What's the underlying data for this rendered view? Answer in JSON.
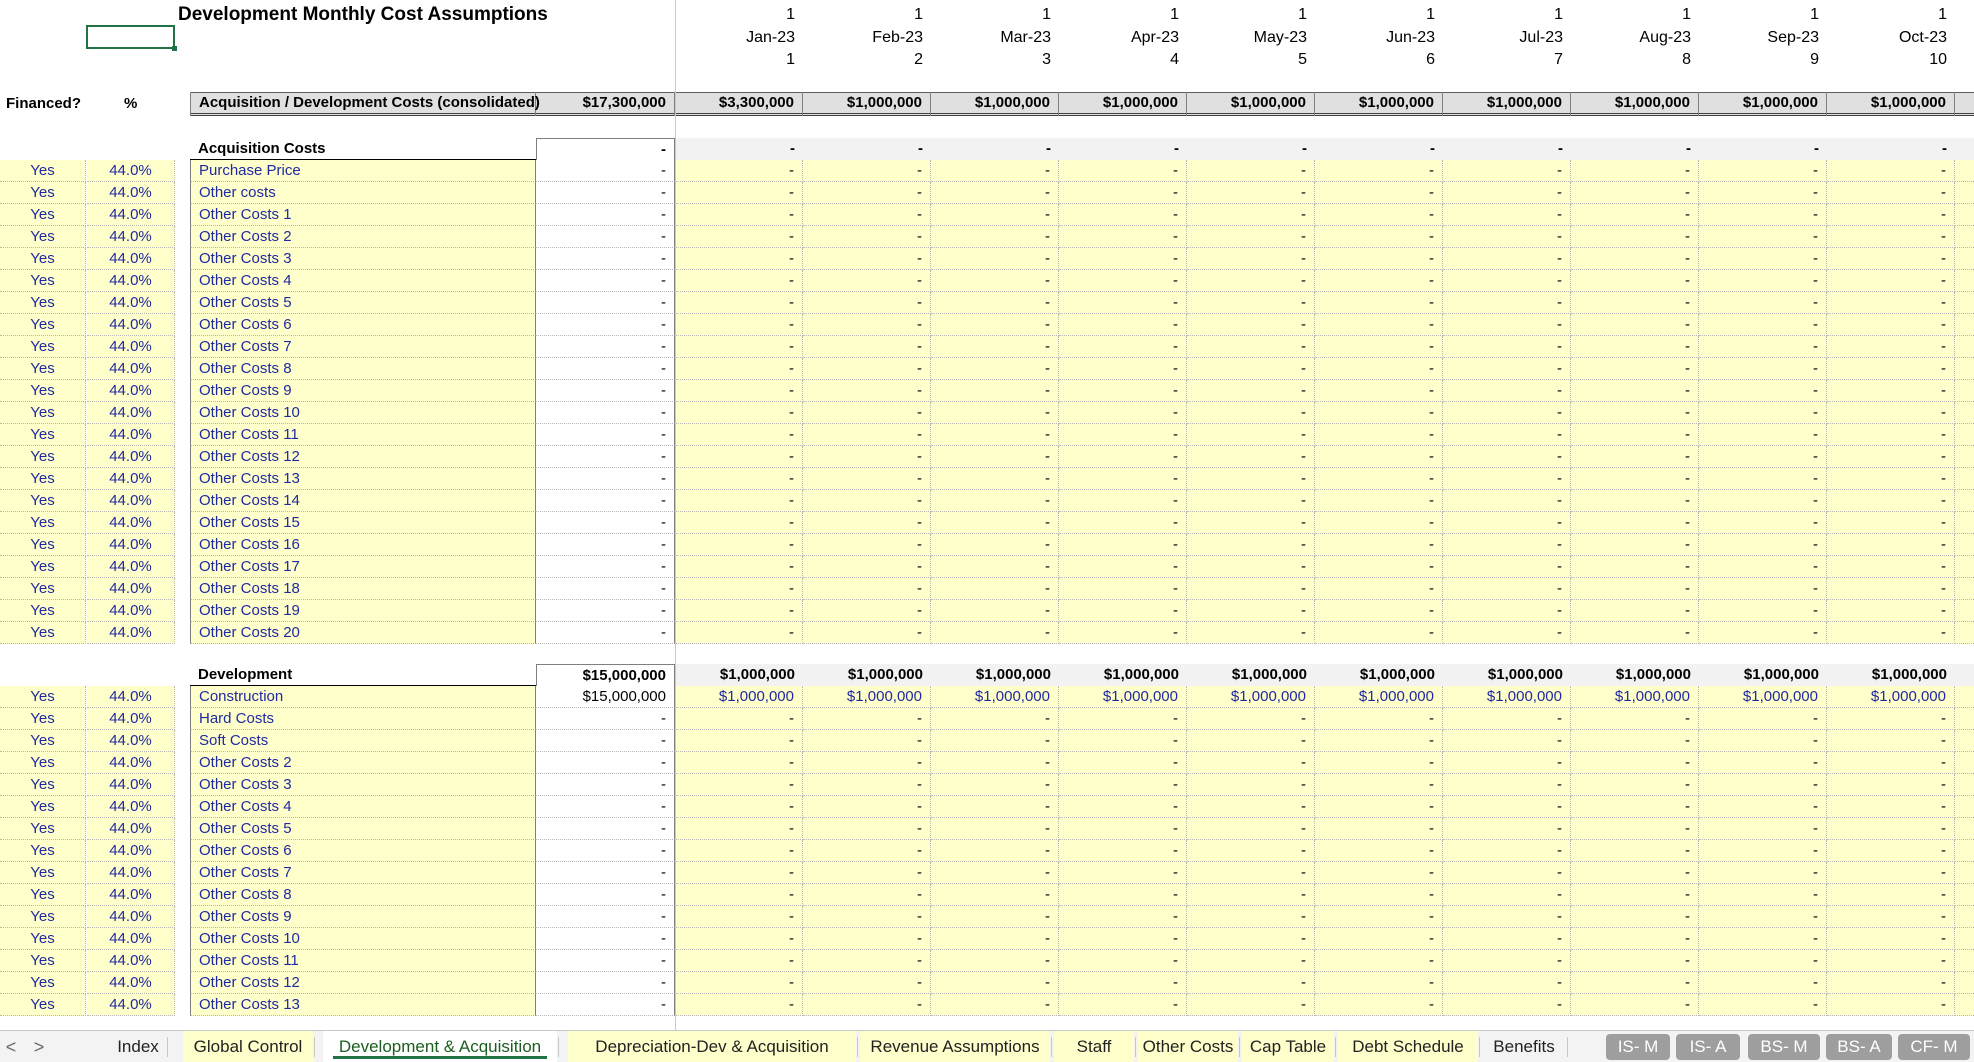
{
  "sheet": {
    "title": "Development Monthly Cost Assumptions",
    "header_left": {
      "financed": "Financed?",
      "pct": "%"
    },
    "months": [
      {
        "top": "1",
        "label": "Jan-23",
        "idx": "1"
      },
      {
        "top": "1",
        "label": "Feb-23",
        "idx": "2"
      },
      {
        "top": "1",
        "label": "Mar-23",
        "idx": "3"
      },
      {
        "top": "1",
        "label": "Apr-23",
        "idx": "4"
      },
      {
        "top": "1",
        "label": "May-23",
        "idx": "5"
      },
      {
        "top": "1",
        "label": "Jun-23",
        "idx": "6"
      },
      {
        "top": "1",
        "label": "Jul-23",
        "idx": "7"
      },
      {
        "top": "1",
        "label": "Aug-23",
        "idx": "8"
      },
      {
        "top": "1",
        "label": "Sep-23",
        "idx": "9"
      },
      {
        "top": "1",
        "label": "Oct-23",
        "idx": "10"
      }
    ],
    "consolidated": {
      "label": "Acquisition / Development Costs (consolidated)",
      "total": "$17,300,000",
      "values": [
        "$3,300,000",
        "$1,000,000",
        "$1,000,000",
        "$1,000,000",
        "$1,000,000",
        "$1,000,000",
        "$1,000,000",
        "$1,000,000",
        "$1,000,000",
        "$1,000,000"
      ]
    },
    "acquisition": {
      "heading": "Acquisition Costs",
      "total": "-",
      "month_totals": [
        "-",
        "-",
        "-",
        "-",
        "-",
        "-",
        "-",
        "-",
        "-",
        "-"
      ],
      "rows": [
        {
          "financed": "Yes",
          "pct": "44.0%",
          "label": "Purchase Price",
          "total": "-",
          "values": [
            "-",
            "-",
            "-",
            "-",
            "-",
            "-",
            "-",
            "-",
            "-",
            "-"
          ]
        },
        {
          "financed": "Yes",
          "pct": "44.0%",
          "label": "Other costs",
          "total": "-",
          "values": [
            "-",
            "-",
            "-",
            "-",
            "-",
            "-",
            "-",
            "-",
            "-",
            "-"
          ]
        },
        {
          "financed": "Yes",
          "pct": "44.0%",
          "label": "Other Costs 1",
          "total": "-",
          "values": [
            "-",
            "-",
            "-",
            "-",
            "-",
            "-",
            "-",
            "-",
            "-",
            "-"
          ]
        },
        {
          "financed": "Yes",
          "pct": "44.0%",
          "label": "Other Costs 2",
          "total": "-",
          "values": [
            "-",
            "-",
            "-",
            "-",
            "-",
            "-",
            "-",
            "-",
            "-",
            "-"
          ]
        },
        {
          "financed": "Yes",
          "pct": "44.0%",
          "label": "Other Costs 3",
          "total": "-",
          "values": [
            "-",
            "-",
            "-",
            "-",
            "-",
            "-",
            "-",
            "-",
            "-",
            "-"
          ]
        },
        {
          "financed": "Yes",
          "pct": "44.0%",
          "label": "Other Costs 4",
          "total": "-",
          "values": [
            "-",
            "-",
            "-",
            "-",
            "-",
            "-",
            "-",
            "-",
            "-",
            "-"
          ]
        },
        {
          "financed": "Yes",
          "pct": "44.0%",
          "label": "Other Costs 5",
          "total": "-",
          "values": [
            "-",
            "-",
            "-",
            "-",
            "-",
            "-",
            "-",
            "-",
            "-",
            "-"
          ]
        },
        {
          "financed": "Yes",
          "pct": "44.0%",
          "label": "Other Costs 6",
          "total": "-",
          "values": [
            "-",
            "-",
            "-",
            "-",
            "-",
            "-",
            "-",
            "-",
            "-",
            "-"
          ]
        },
        {
          "financed": "Yes",
          "pct": "44.0%",
          "label": "Other Costs 7",
          "total": "-",
          "values": [
            "-",
            "-",
            "-",
            "-",
            "-",
            "-",
            "-",
            "-",
            "-",
            "-"
          ]
        },
        {
          "financed": "Yes",
          "pct": "44.0%",
          "label": "Other Costs 8",
          "total": "-",
          "values": [
            "-",
            "-",
            "-",
            "-",
            "-",
            "-",
            "-",
            "-",
            "-",
            "-"
          ]
        },
        {
          "financed": "Yes",
          "pct": "44.0%",
          "label": "Other Costs 9",
          "total": "-",
          "values": [
            "-",
            "-",
            "-",
            "-",
            "-",
            "-",
            "-",
            "-",
            "-",
            "-"
          ]
        },
        {
          "financed": "Yes",
          "pct": "44.0%",
          "label": "Other Costs 10",
          "total": "-",
          "values": [
            "-",
            "-",
            "-",
            "-",
            "-",
            "-",
            "-",
            "-",
            "-",
            "-"
          ]
        },
        {
          "financed": "Yes",
          "pct": "44.0%",
          "label": "Other Costs 11",
          "total": "-",
          "values": [
            "-",
            "-",
            "-",
            "-",
            "-",
            "-",
            "-",
            "-",
            "-",
            "-"
          ]
        },
        {
          "financed": "Yes",
          "pct": "44.0%",
          "label": "Other Costs 12",
          "total": "-",
          "values": [
            "-",
            "-",
            "-",
            "-",
            "-",
            "-",
            "-",
            "-",
            "-",
            "-"
          ]
        },
        {
          "financed": "Yes",
          "pct": "44.0%",
          "label": "Other Costs 13",
          "total": "-",
          "values": [
            "-",
            "-",
            "-",
            "-",
            "-",
            "-",
            "-",
            "-",
            "-",
            "-"
          ]
        },
        {
          "financed": "Yes",
          "pct": "44.0%",
          "label": "Other Costs 14",
          "total": "-",
          "values": [
            "-",
            "-",
            "-",
            "-",
            "-",
            "-",
            "-",
            "-",
            "-",
            "-"
          ]
        },
        {
          "financed": "Yes",
          "pct": "44.0%",
          "label": "Other Costs 15",
          "total": "-",
          "values": [
            "-",
            "-",
            "-",
            "-",
            "-",
            "-",
            "-",
            "-",
            "-",
            "-"
          ]
        },
        {
          "financed": "Yes",
          "pct": "44.0%",
          "label": "Other Costs 16",
          "total": "-",
          "values": [
            "-",
            "-",
            "-",
            "-",
            "-",
            "-",
            "-",
            "-",
            "-",
            "-"
          ]
        },
        {
          "financed": "Yes",
          "pct": "44.0%",
          "label": "Other Costs 17",
          "total": "-",
          "values": [
            "-",
            "-",
            "-",
            "-",
            "-",
            "-",
            "-",
            "-",
            "-",
            "-"
          ]
        },
        {
          "financed": "Yes",
          "pct": "44.0%",
          "label": "Other Costs 18",
          "total": "-",
          "values": [
            "-",
            "-",
            "-",
            "-",
            "-",
            "-",
            "-",
            "-",
            "-",
            "-"
          ]
        },
        {
          "financed": "Yes",
          "pct": "44.0%",
          "label": "Other Costs 19",
          "total": "-",
          "values": [
            "-",
            "-",
            "-",
            "-",
            "-",
            "-",
            "-",
            "-",
            "-",
            "-"
          ]
        },
        {
          "financed": "Yes",
          "pct": "44.0%",
          "label": "Other Costs 20",
          "total": "-",
          "values": [
            "-",
            "-",
            "-",
            "-",
            "-",
            "-",
            "-",
            "-",
            "-",
            "-"
          ]
        }
      ]
    },
    "development": {
      "heading": "Development",
      "total": "$15,000,000",
      "month_totals": [
        "$1,000,000",
        "$1,000,000",
        "$1,000,000",
        "$1,000,000",
        "$1,000,000",
        "$1,000,000",
        "$1,000,000",
        "$1,000,000",
        "$1,000,000",
        "$1,000,000"
      ],
      "rows": [
        {
          "financed": "Yes",
          "pct": "44.0%",
          "label": "Construction",
          "total": "$15,000,000",
          "values": [
            "$1,000,000",
            "$1,000,000",
            "$1,000,000",
            "$1,000,000",
            "$1,000,000",
            "$1,000,000",
            "$1,000,000",
            "$1,000,000",
            "$1,000,000",
            "$1,000,000"
          ]
        },
        {
          "financed": "Yes",
          "pct": "44.0%",
          "label": "Hard Costs",
          "total": "-",
          "values": [
            "-",
            "-",
            "-",
            "-",
            "-",
            "-",
            "-",
            "-",
            "-",
            "-"
          ]
        },
        {
          "financed": "Yes",
          "pct": "44.0%",
          "label": "Soft Costs",
          "total": "-",
          "values": [
            "-",
            "-",
            "-",
            "-",
            "-",
            "-",
            "-",
            "-",
            "-",
            "-"
          ]
        },
        {
          "financed": "Yes",
          "pct": "44.0%",
          "label": "Other Costs 2",
          "total": "-",
          "values": [
            "-",
            "-",
            "-",
            "-",
            "-",
            "-",
            "-",
            "-",
            "-",
            "-"
          ]
        },
        {
          "financed": "Yes",
          "pct": "44.0%",
          "label": "Other Costs 3",
          "total": "-",
          "values": [
            "-",
            "-",
            "-",
            "-",
            "-",
            "-",
            "-",
            "-",
            "-",
            "-"
          ]
        },
        {
          "financed": "Yes",
          "pct": "44.0%",
          "label": "Other Costs 4",
          "total": "-",
          "values": [
            "-",
            "-",
            "-",
            "-",
            "-",
            "-",
            "-",
            "-",
            "-",
            "-"
          ]
        },
        {
          "financed": "Yes",
          "pct": "44.0%",
          "label": "Other Costs 5",
          "total": "-",
          "values": [
            "-",
            "-",
            "-",
            "-",
            "-",
            "-",
            "-",
            "-",
            "-",
            "-"
          ]
        },
        {
          "financed": "Yes",
          "pct": "44.0%",
          "label": "Other Costs 6",
          "total": "-",
          "values": [
            "-",
            "-",
            "-",
            "-",
            "-",
            "-",
            "-",
            "-",
            "-",
            "-"
          ]
        },
        {
          "financed": "Yes",
          "pct": "44.0%",
          "label": "Other Costs 7",
          "total": "-",
          "values": [
            "-",
            "-",
            "-",
            "-",
            "-",
            "-",
            "-",
            "-",
            "-",
            "-"
          ]
        },
        {
          "financed": "Yes",
          "pct": "44.0%",
          "label": "Other Costs 8",
          "total": "-",
          "values": [
            "-",
            "-",
            "-",
            "-",
            "-",
            "-",
            "-",
            "-",
            "-",
            "-"
          ]
        },
        {
          "financed": "Yes",
          "pct": "44.0%",
          "label": "Other Costs 9",
          "total": "-",
          "values": [
            "-",
            "-",
            "-",
            "-",
            "-",
            "-",
            "-",
            "-",
            "-",
            "-"
          ]
        },
        {
          "financed": "Yes",
          "pct": "44.0%",
          "label": "Other Costs 10",
          "total": "-",
          "values": [
            "-",
            "-",
            "-",
            "-",
            "-",
            "-",
            "-",
            "-",
            "-",
            "-"
          ]
        },
        {
          "financed": "Yes",
          "pct": "44.0%",
          "label": "Other Costs 11",
          "total": "-",
          "values": [
            "-",
            "-",
            "-",
            "-",
            "-",
            "-",
            "-",
            "-",
            "-",
            "-"
          ]
        },
        {
          "financed": "Yes",
          "pct": "44.0%",
          "label": "Other Costs 12",
          "total": "-",
          "values": [
            "-",
            "-",
            "-",
            "-",
            "-",
            "-",
            "-",
            "-",
            "-",
            "-"
          ]
        },
        {
          "financed": "Yes",
          "pct": "44.0%",
          "label": "Other Costs 13",
          "total": "-",
          "values": [
            "-",
            "-",
            "-",
            "-",
            "-",
            "-",
            "-",
            "-",
            "-",
            "-"
          ]
        }
      ]
    }
  },
  "tabs": {
    "nav_prev": "<",
    "nav_next": ">",
    "items": [
      {
        "label": "Index",
        "style": "plain"
      },
      {
        "label": "Global Control",
        "style": "yellow"
      },
      {
        "label": "Development & Acquisition",
        "style": "active"
      },
      {
        "label": "Depreciation-Dev & Acquisition",
        "style": "yellow"
      },
      {
        "label": "Revenue Assumptions",
        "style": "yellow"
      },
      {
        "label": "Staff",
        "style": "yellow"
      },
      {
        "label": "Other Costs",
        "style": "yellow"
      },
      {
        "label": "Cap Table",
        "style": "yellow"
      },
      {
        "label": "Debt Schedule",
        "style": "yellow"
      },
      {
        "label": "Benefits",
        "style": "plain"
      },
      {
        "label": "IS- M",
        "style": "grey"
      },
      {
        "label": "IS- A",
        "style": "grey"
      },
      {
        "label": "BS- M",
        "style": "grey"
      },
      {
        "label": "BS- A",
        "style": "grey"
      },
      {
        "label": "CF- M",
        "style": "grey"
      }
    ]
  },
  "colors": {
    "input_fill": "#ffffcc",
    "input_font": "#1f2aa0",
    "active_tab_accent": "#217346",
    "grey_tab": "#9e9e9e"
  }
}
